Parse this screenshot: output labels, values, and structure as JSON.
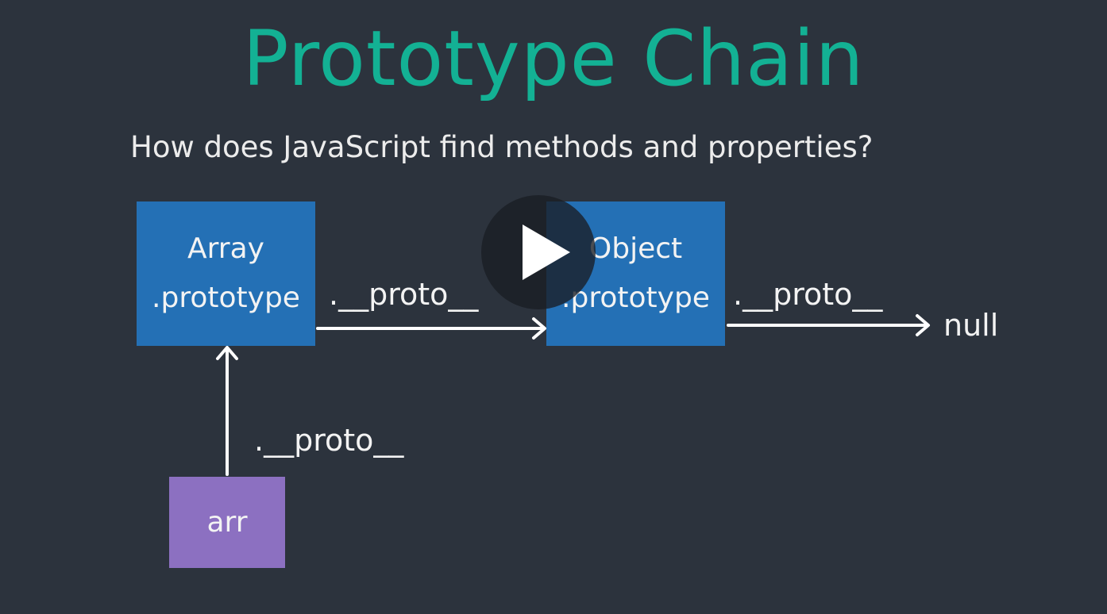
{
  "slide": {
    "title": "Prototype Chain",
    "subtitle": "How does JavaScript find methods and properties?"
  },
  "nodes": {
    "array_prototype": {
      "line1": "Array",
      "line2": ".prototype"
    },
    "object_prototype": {
      "line1": "Object",
      "line2": ".prototype"
    },
    "arr": {
      "label": "arr"
    },
    "null": {
      "label": "null"
    }
  },
  "edges": {
    "arr_to_array": ".__proto__",
    "array_to_object": ".__proto__",
    "object_to_null": ".__proto__"
  },
  "player": {
    "play_icon": "play-icon"
  },
  "colors": {
    "background": "#2c333d",
    "title": "#13b194",
    "prototype_box": "#2470b5",
    "instance_box": "#8c70c1"
  }
}
